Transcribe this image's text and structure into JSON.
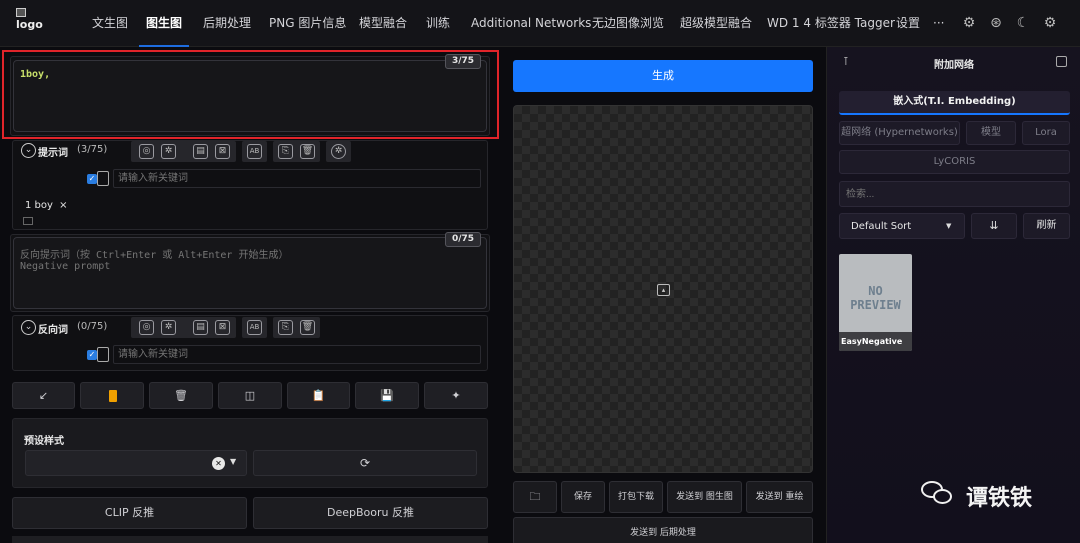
{
  "header": {
    "logo_text": "logo",
    "tabs": [
      {
        "label": "文生图"
      },
      {
        "label": "图生图",
        "active": true
      },
      {
        "label": "后期处理"
      },
      {
        "label": "PNG 图片信息"
      },
      {
        "label": "模型融合"
      },
      {
        "label": "训练"
      },
      {
        "label": "Additional Networks"
      },
      {
        "label": "无边图像浏览"
      },
      {
        "label": "超级模型融合"
      },
      {
        "label": "WD 1 4 标签器 Tagger"
      },
      {
        "label": "设置"
      },
      {
        "label": "···"
      }
    ],
    "icons": [
      "settings-icon",
      "github-icon",
      "moon-icon",
      "gear-icon"
    ]
  },
  "prompt": {
    "value": "1boy,",
    "counter": "3/75",
    "label": "提示词",
    "label_count": "(3/75)",
    "keyword_placeholder": "请输入新关键词",
    "tag": "1 boy",
    "tag_close": "×"
  },
  "negative": {
    "placeholder": "反向提示词（按 Ctrl+Enter 或 Alt+Enter 开始生成）\nNegative prompt",
    "counter": "0/75",
    "label": "反向词",
    "label_count": "(0/75)",
    "keyword_placeholder": "请输入新关键词"
  },
  "styles": {
    "title": "预设样式",
    "clear_symbol": "✕"
  },
  "interrogate": {
    "clip": "CLIP 反推",
    "deepbooru": "DeepBooru 反推"
  },
  "generate": {
    "label": "生成"
  },
  "output_actions": {
    "save": "保存",
    "zip": "打包下载",
    "send_img2img": "发送到 图生图",
    "send_inpaint": "发送到 重绘",
    "send_extras": "发送到 后期处理"
  },
  "extra_networks": {
    "title": "附加网络",
    "tabs": [
      {
        "label": "嵌入式(T.I. Embedding)",
        "active": true
      },
      {
        "label": "超网络 (Hypernetworks)"
      },
      {
        "label": "模型"
      },
      {
        "label": "Lora"
      },
      {
        "label": "LyCORIS"
      }
    ],
    "search_placeholder": "检索...",
    "sort_value": "Default Sort",
    "refresh": "刷新",
    "card": {
      "preview_text": "NO\nPREVIEW",
      "name": "EasyNegative"
    }
  },
  "watermark": {
    "text": "谭铁铁"
  },
  "colors": {
    "accent": "#1677ff",
    "highlight_border": "#e0242a"
  }
}
